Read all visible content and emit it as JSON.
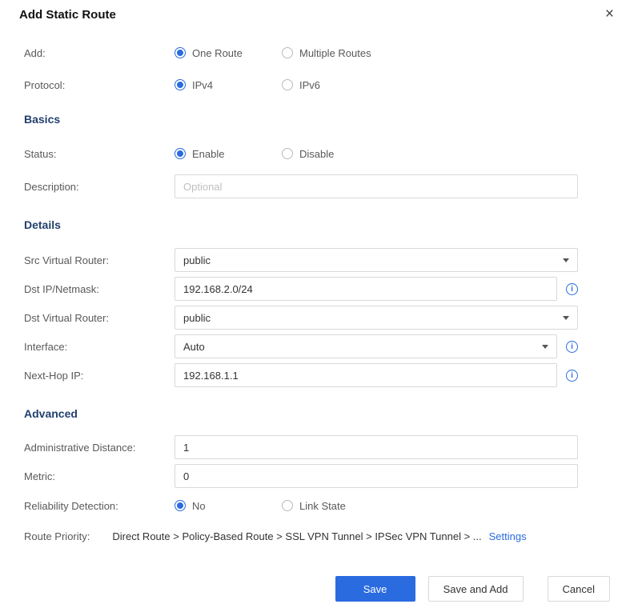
{
  "dialog": {
    "title": "Add Static Route"
  },
  "icons": {
    "close": "×",
    "info": "i"
  },
  "sections": {
    "basics": "Basics",
    "details": "Details",
    "advanced": "Advanced"
  },
  "rows": {
    "add": {
      "label": "Add:",
      "options": [
        {
          "label": "One Route",
          "selected": true
        },
        {
          "label": "Multiple Routes",
          "selected": false
        }
      ]
    },
    "protocol": {
      "label": "Protocol:",
      "options": [
        {
          "label": "IPv4",
          "selected": true
        },
        {
          "label": "IPv6",
          "selected": false
        }
      ]
    },
    "status": {
      "label": "Status:",
      "options": [
        {
          "label": "Enable",
          "selected": true
        },
        {
          "label": "Disable",
          "selected": false
        }
      ]
    },
    "description": {
      "label": "Description:",
      "placeholder": "Optional",
      "value": ""
    },
    "src_virtual_router": {
      "label": "Src Virtual Router:",
      "value": "public"
    },
    "dst_ip_netmask": {
      "label": "Dst IP/Netmask:",
      "value": "192.168.2.0/24"
    },
    "dst_virtual_router": {
      "label": "Dst Virtual Router:",
      "value": "public"
    },
    "interface": {
      "label": "Interface:",
      "value": "Auto"
    },
    "next_hop_ip": {
      "label": "Next-Hop IP:",
      "value": "192.168.1.1"
    },
    "administrative_distance": {
      "label": "Administrative Distance:",
      "value": "1"
    },
    "metric": {
      "label": "Metric:",
      "value": "0"
    },
    "reliability_detection": {
      "label": "Reliability Detection:",
      "options": [
        {
          "label": "No",
          "selected": true
        },
        {
          "label": "Link State",
          "selected": false
        }
      ]
    },
    "route_priority": {
      "label": "Route Priority:",
      "text": "Direct Route > Policy-Based Route > SSL VPN Tunnel > IPSec VPN Tunnel > ...",
      "link": "Settings"
    }
  },
  "buttons": {
    "save": "Save",
    "save_and_add": "Save and Add",
    "cancel": "Cancel"
  },
  "colors": {
    "primary": "#2a6be0",
    "heading": "#23406e"
  }
}
